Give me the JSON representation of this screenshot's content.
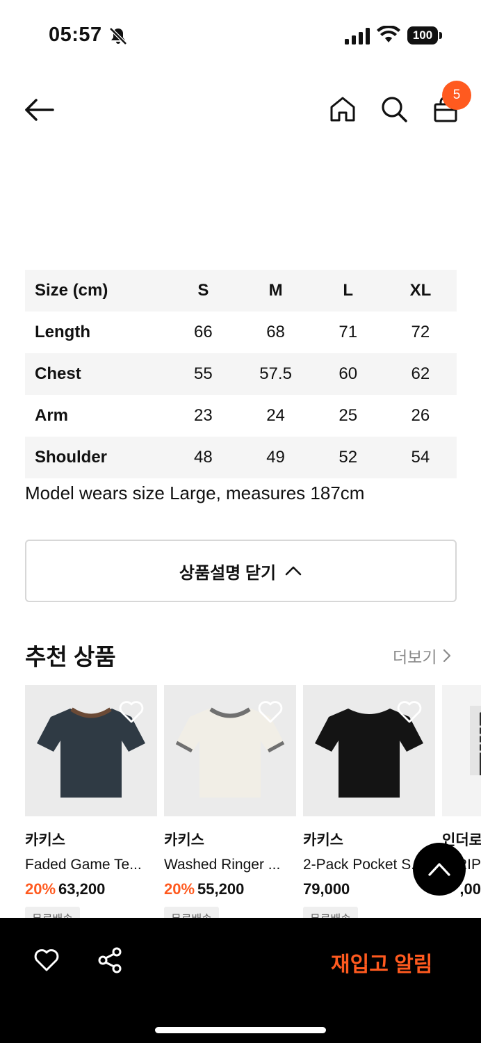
{
  "status_bar": {
    "time": "05:57",
    "battery": "100"
  },
  "nav": {
    "cart_count": "5"
  },
  "size_table": {
    "header": {
      "label": "Size (cm)",
      "sizes": [
        "S",
        "M",
        "L",
        "XL"
      ]
    },
    "rows": [
      {
        "label": "Length",
        "values": [
          "66",
          "68",
          "71",
          "72"
        ]
      },
      {
        "label": "Chest",
        "values": [
          "55",
          "57.5",
          "60",
          "62"
        ]
      },
      {
        "label": "Arm",
        "values": [
          "23",
          "24",
          "25",
          "26"
        ]
      },
      {
        "label": "Shoulder",
        "values": [
          "48",
          "49",
          "52",
          "54"
        ]
      }
    ]
  },
  "model_note": "Model wears size Large, measures 187cm",
  "close_description": "상품설명 닫기",
  "recommended": {
    "title": "추천 상품",
    "more_label": "더보기",
    "products": [
      {
        "brand": "카키스",
        "name": "Faded Game Te...",
        "discount": "20%",
        "price": "63,200",
        "tag": "무료배송",
        "shirt_color": "#2f3a44",
        "trim_color": "#6b4a36"
      },
      {
        "brand": "카키스",
        "name": "Washed Ringer ...",
        "discount": "20%",
        "price": "55,200",
        "tag": "무료배송",
        "shirt_color": "#f1eee6",
        "trim_color": "#707070"
      },
      {
        "brand": "카키스",
        "name": "2-Pack Pocket S...",
        "discount": "",
        "price": "79,000",
        "tag": "무료배송",
        "shirt_color": "#141414",
        "trim_color": "#141414"
      },
      {
        "brand": "인더로우",
        "name": "RIP",
        "discount": "",
        "price": ",00",
        "tag": "",
        "shirt_color": "#2a2a2a",
        "trim_color": "#2a2a2a"
      }
    ]
  },
  "bottom_bar": {
    "restock_label": "재입고 알림"
  },
  "colors": {
    "accent": "#ff5a1f"
  }
}
